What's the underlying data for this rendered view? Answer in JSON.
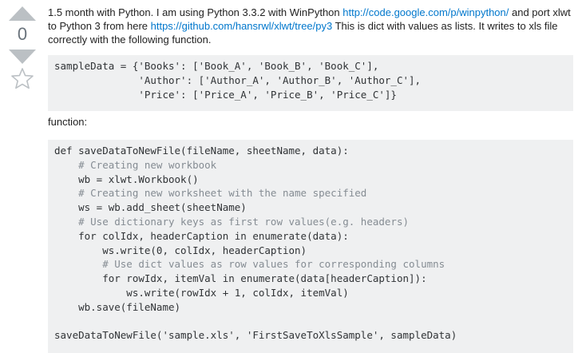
{
  "vote": {
    "count": "0",
    "up_label": "up vote",
    "down_label": "down vote",
    "favorite_label": "favorite"
  },
  "intro": {
    "text1": "1.5 month with Python. I am using Python 3.3.2 with WinPython ",
    "link1": "http://code.google.com/p/winpython/",
    "text2": " and port xlwt to Python 3 from here ",
    "link2": "https://github.com/hansrwl/xlwt/tree/py3",
    "text3": " This is dict with values as lists. It writes to xls file correctly with the following function."
  },
  "function_label": "function:",
  "code_sample": {
    "line1": "sampleData = {'Books': ['Book_A', 'Book_B', 'Book_C'],",
    "line2": "              'Author': ['Author_A', 'Author_B', 'Author_C'],",
    "line3": "              'Price': ['Price_A', 'Price_B', 'Price_C']}"
  },
  "code_function": {
    "lines": [
      "def saveDataToNewFile(fileName, sheetName, data):",
      "    # Creating new workbook",
      "    wb = xlwt.Workbook()",
      "    # Creating new worksheet with the name specified",
      "    ws = wb.add_sheet(sheetName)",
      "    # Use dictionary keys as first row values(e.g. headers)",
      "    for colIdx, headerCaption in enumerate(data):",
      "        ws.write(0, colIdx, headerCaption)",
      "        # Use dict values as row values for corresponding columns",
      "        for rowIdx, itemVal in enumerate(data[headerCaption]):",
      "            ws.write(rowIdx + 1, colIdx, itemVal)",
      "    wb.save(fileName)",
      "",
      "saveDataToNewFile('sample.xls', 'FirstSaveToXlsSample', sampleData)"
    ]
  }
}
